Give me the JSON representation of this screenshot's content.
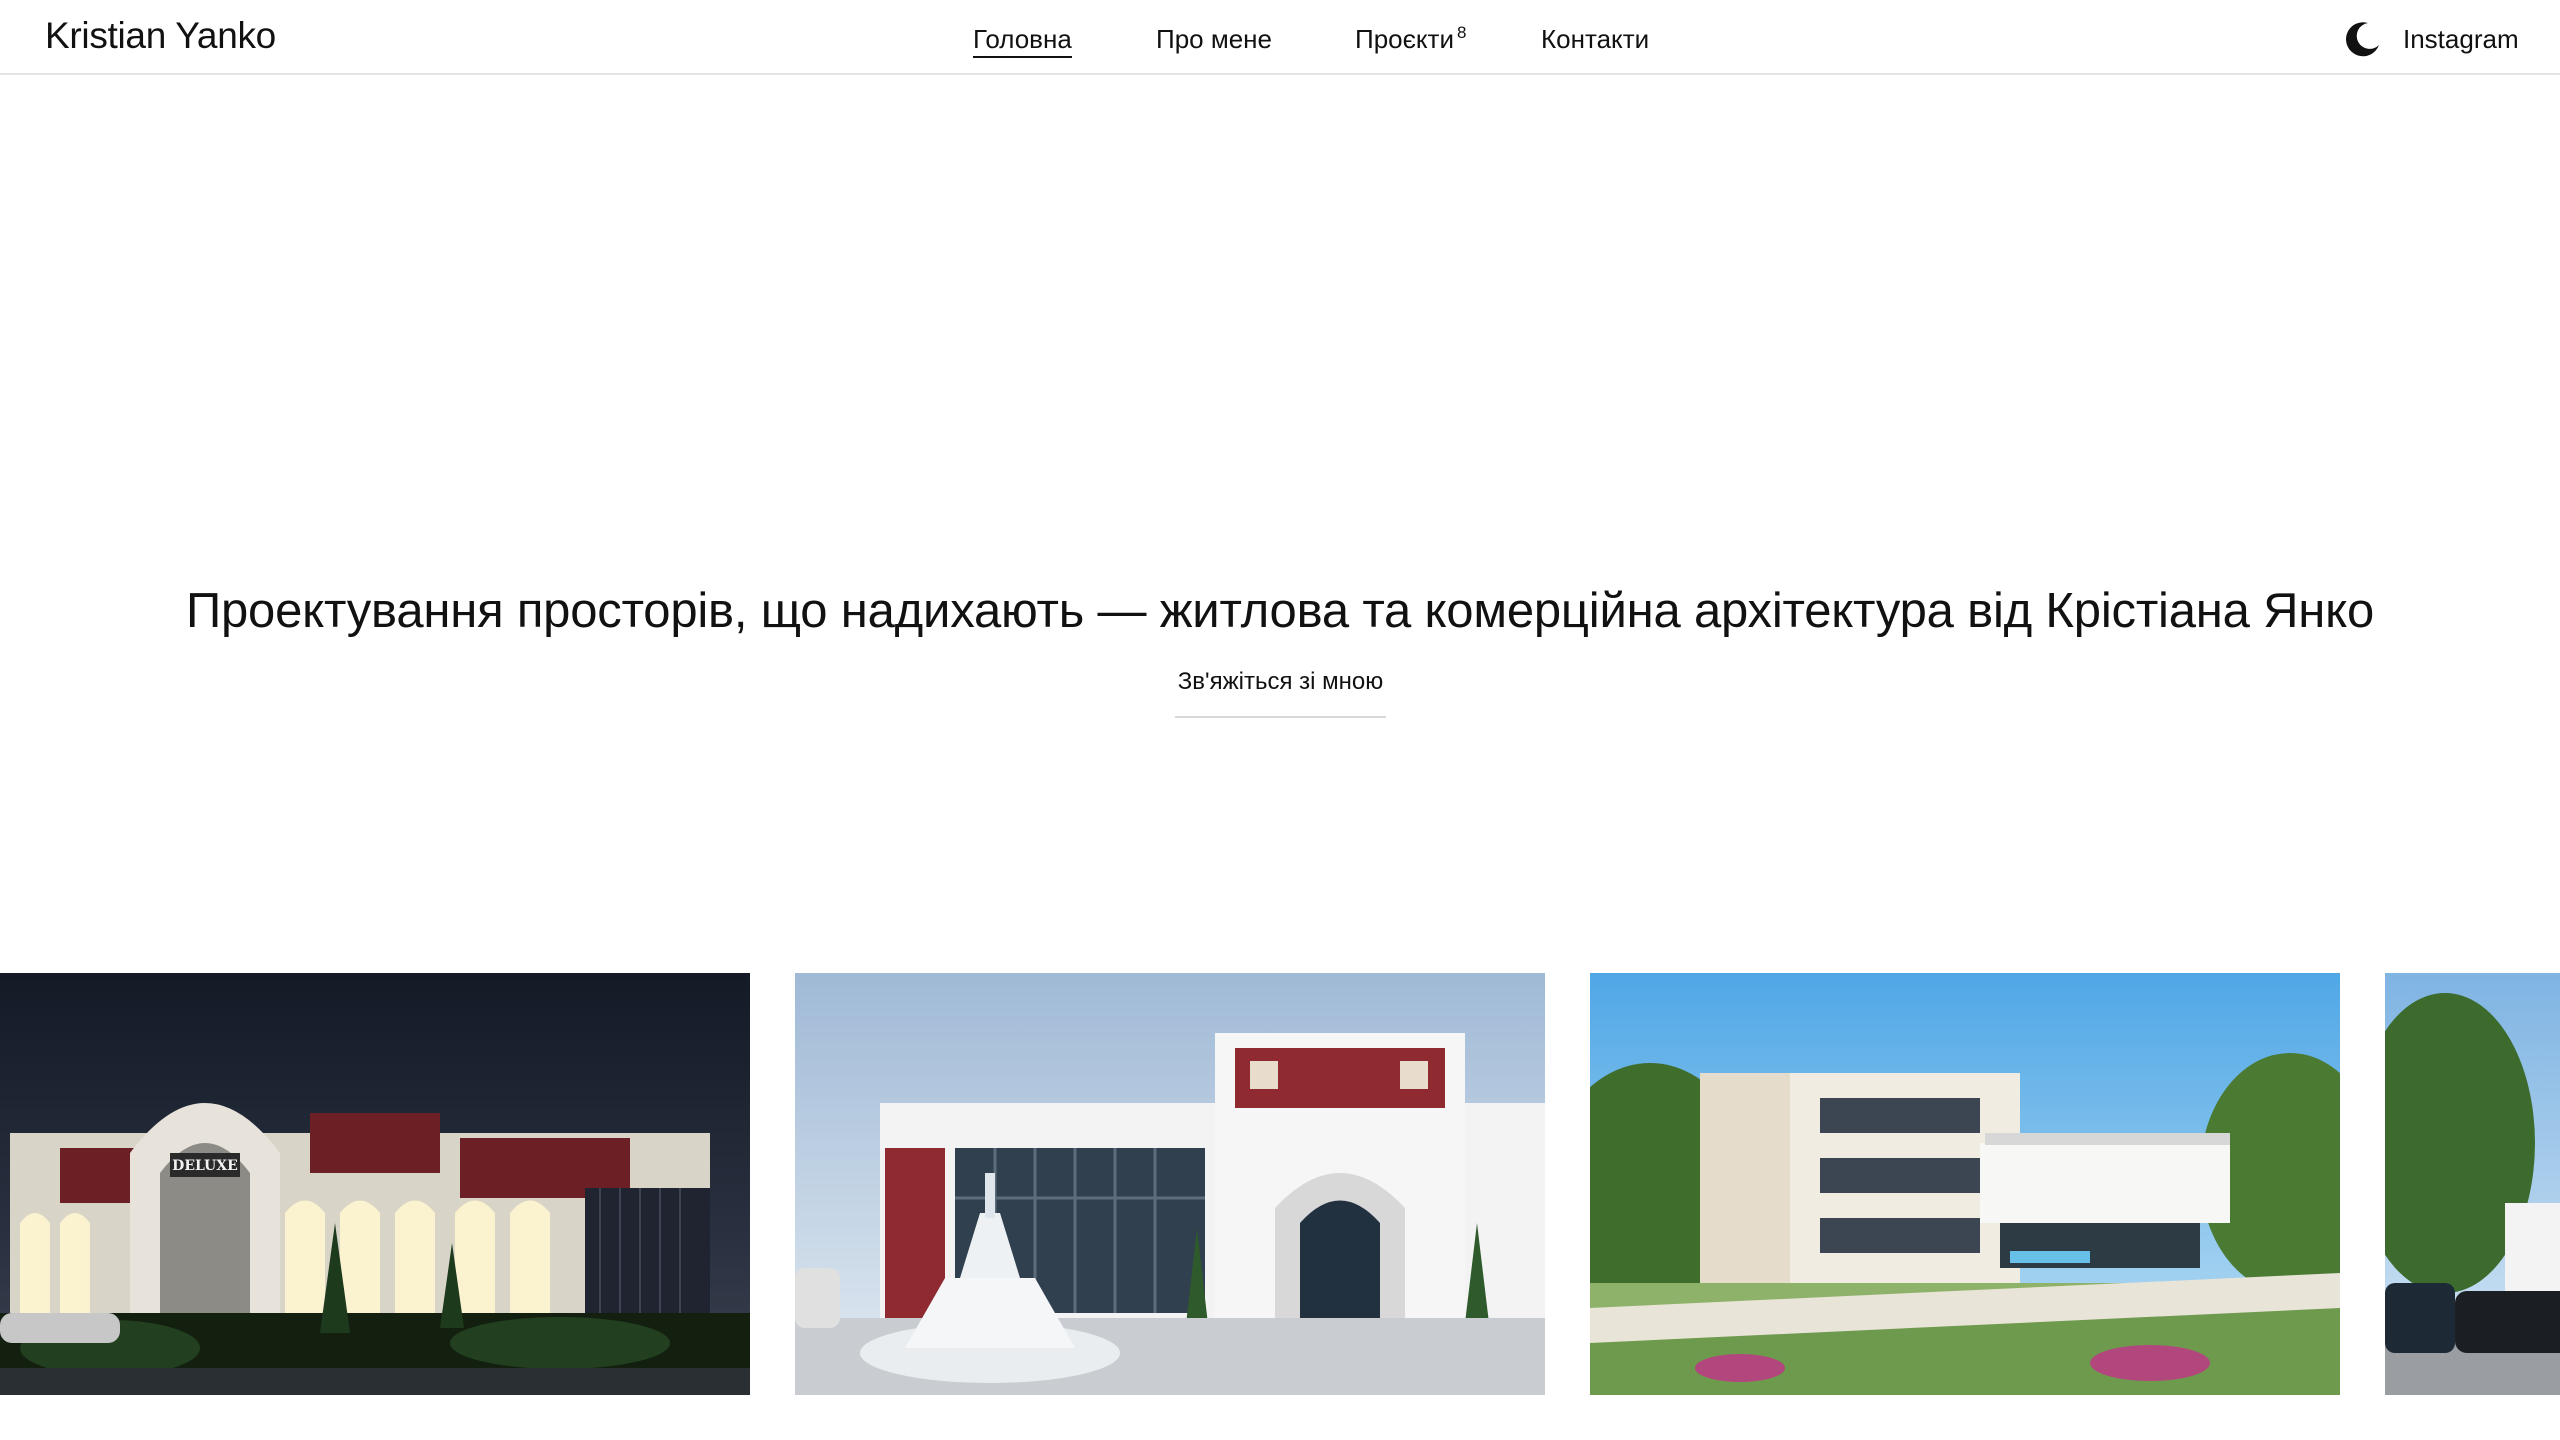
{
  "header": {
    "brand": "Kristian Yanko",
    "nav": [
      {
        "label": "Головна",
        "active": true
      },
      {
        "label": "Про мене",
        "active": false
      },
      {
        "label": "Проєкти",
        "active": false,
        "badge": "8"
      },
      {
        "label": "Контакти",
        "active": false
      }
    ],
    "theme_icon": "moon-icon",
    "instagram_label": "Instagram"
  },
  "hero": {
    "title": "Проектування просторів, що надихають — житлова та комерційна архітектура від Крістіана Янко",
    "cta_label": "Зв'яжіться зі мною"
  },
  "gallery": {
    "cards": [
      {
        "sign_text": "DELUXE"
      },
      {},
      {},
      {}
    ]
  },
  "colors": {
    "text": "#111111",
    "divider": "#e4e4e4",
    "background": "#ffffff"
  }
}
